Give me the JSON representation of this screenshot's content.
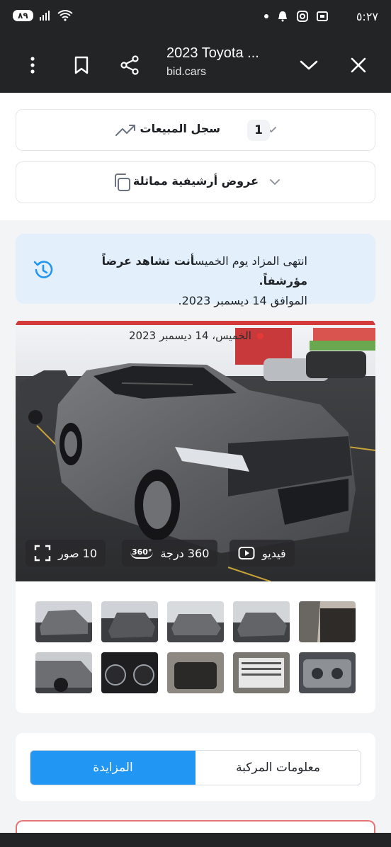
{
  "status_bar": {
    "time": "٥:٢٧",
    "battery": "٨٩"
  },
  "toolbar": {
    "title": "2023 Toyota ...",
    "domain": "bid.cars"
  },
  "sales_history": {
    "label": "سجل المبيعات",
    "count": "1"
  },
  "similar_archive": {
    "label": "عروض أرشيفية مماثلة"
  },
  "notice": {
    "line_prefix": "انتهى المزاد يوم الخميس",
    "line_bold": "أنت تشاهد عرضاً مؤرشفاً.",
    "line_date": "الموافق 14 ديسمبر 2023."
  },
  "photo": {
    "date_label": "الخميس، 14 ديسمبر 2023",
    "photos_button": "10 صور",
    "degree_button": "360 درجة",
    "video_button": "فيديو",
    "badge_360": "360°"
  },
  "tabs": {
    "vehicle_info": "معلومات المركبة",
    "auction": "المزايدة"
  },
  "colors": {
    "accent": "#2196f3",
    "notice_bg": "#e3f0fb",
    "toolbar_bg": "#222426",
    "live_dot": "#e53935"
  }
}
